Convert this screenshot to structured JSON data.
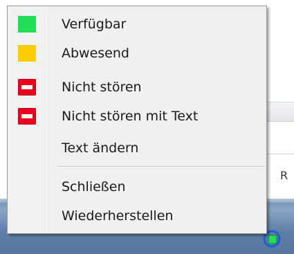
{
  "menu": {
    "items": [
      {
        "label": "Verfügbar",
        "icon": "status-available-icon",
        "color": "#22dd55"
      },
      {
        "label": "Abwesend",
        "icon": "status-away-icon",
        "color": "#ffcc00"
      },
      {
        "label": "Nicht stören",
        "icon": "status-do-not-disturb-icon",
        "color": "#e8001c"
      },
      {
        "label": "Nicht stören mit Text",
        "icon": "status-do-not-disturb-text-icon",
        "color": "#e8001c"
      },
      {
        "label": "Text ändern"
      },
      {
        "label": "Schließen"
      },
      {
        "label": "Wiederherstellen"
      }
    ]
  },
  "background": {
    "partial_letter": "R"
  }
}
